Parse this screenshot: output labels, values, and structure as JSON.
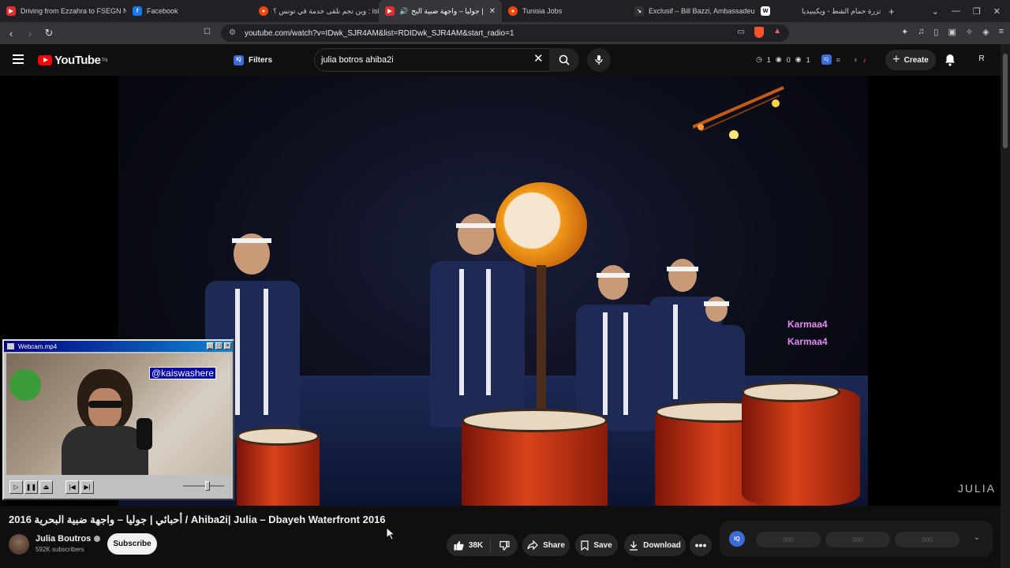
{
  "browser": {
    "tabs": [
      {
        "title": "Driving from Ezzahra to FSEGN Nab",
        "favicon_color": "#e32c2c",
        "favicon": "youtube-icon"
      },
      {
        "title": "Facebook",
        "favicon_color": "#1877f2",
        "favicon": "facebook-icon"
      },
      {
        "title": "وين نجم نلقى خدمة في تونس ؟ : isia",
        "favicon_color": "#ff4500",
        "favicon": "reddit-icon"
      },
      {
        "title": "أحبائي | جوليا – واجهة ضبية البح",
        "favicon_color": "#e32c2c",
        "favicon": "youtube-icon",
        "active": true
      },
      {
        "title": "Tunisia Jobs",
        "favicon_color": "#ff4500",
        "favicon": "reddit-icon"
      },
      {
        "title": "Exclusif – Bill Bazzi, Ambassadeur de",
        "favicon_color": "#888888",
        "favicon": "news-icon"
      },
      {
        "title": "مجزرة حمام الشط - ويكيبيديا",
        "favicon_color": "#ffffff",
        "favicon": "wikipedia-icon"
      }
    ],
    "url": "youtube.com/watch?v=IDwk_SJR4AM&list=RDIDwk_SJR4AM&start_radio=1"
  },
  "youtube": {
    "logo_text": "YouTube",
    "logo_sup": "TN",
    "filters_label": "Filters",
    "iq_badge": "IQ",
    "search_query": "julia botros ahiba2i",
    "stats": [
      "1",
      "0",
      "1"
    ],
    "create_label": "Create",
    "avatar_letter": "R"
  },
  "video": {
    "watermark": "JULIA",
    "overlay_lines": [
      "Karmaa4",
      "Karmaa4"
    ],
    "title": "2016 أحبائي | جوليا – واجهة ضبية البحرية / Ahiba2i| Julia – Dbayeh Waterfront 2016",
    "channel": "Julia Boutros",
    "subscribers": "592K subscribers",
    "subscribe_label": "Subscribe",
    "likes": "38K",
    "share_label": "Share",
    "save_label": "Save",
    "download_label": "Download"
  },
  "webcam": {
    "title": "Webcam.mp4",
    "handle": "@kaiswashere"
  },
  "side_panel": {
    "iq_label": "IQ",
    "segments": [
      "000",
      "000",
      "000"
    ]
  }
}
